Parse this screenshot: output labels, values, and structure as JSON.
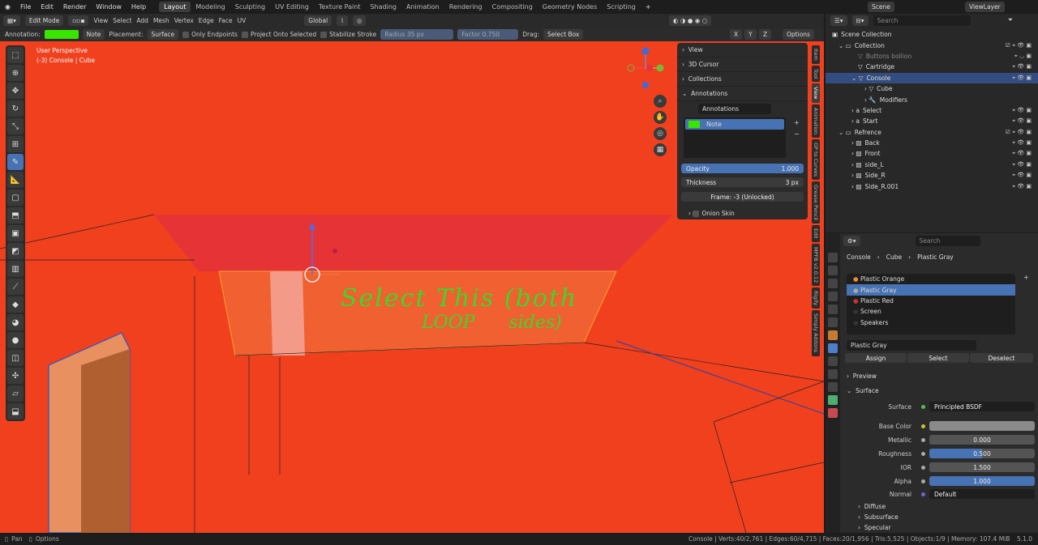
{
  "menu": [
    "File",
    "Edit",
    "Render",
    "Window",
    "Help"
  ],
  "workspaces": [
    "Layout",
    "Modeling",
    "Sculpting",
    "UV Editing",
    "Texture Paint",
    "Shading",
    "Animation",
    "Rendering",
    "Compositing",
    "Geometry Nodes",
    "Scripting"
  ],
  "scene": "Scene",
  "view_layer": "ViewLayer",
  "header": {
    "mode": "Edit Mode",
    "menus": [
      "View",
      "Select",
      "Add",
      "Mesh",
      "Vertex",
      "Edge",
      "Face",
      "UV"
    ],
    "orientation": "Global"
  },
  "toolsettings": {
    "annotation_label": "Annotation:",
    "annotation_color": "#39e600",
    "layer": "Note",
    "placement_label": "Placement:",
    "placement": "Surface",
    "only_endpoints": "Only Endpoints",
    "project": "Project Onto Selected",
    "stabilize": "Stabilize Stroke",
    "radius_label": "Radius",
    "radius": "35 px",
    "factor_label": "Factor",
    "factor": "0.750",
    "drag_label": "Drag:",
    "drag": "Select Box",
    "options": "Options",
    "axes": [
      "X",
      "Y",
      "Z"
    ]
  },
  "viewport": {
    "perspective": "User Perspective",
    "object": "(-3) Console | Cube",
    "annotation_line1": "Select This (both",
    "annotation_line2": "LOOP      sides)"
  },
  "npanel": {
    "sections": [
      "View",
      "3D Cursor",
      "Collections",
      "Annotations"
    ],
    "annotation_name": "Annotations",
    "layer": "Note",
    "opacity_label": "Opacity",
    "opacity": "1.000",
    "thickness_label": "Thickness",
    "thickness": "3 px",
    "frame": "Frame: -3 (Unlocked)",
    "onion": "Onion Skin"
  },
  "vtabs": [
    "Item",
    "Tool",
    "View",
    "Animation",
    "GP to Curves",
    "Grease Pencil",
    "Edit",
    "MPFB v2.0.12",
    "Rigify",
    "Simply Addons"
  ],
  "outliner": {
    "search_placeholder": "Search",
    "rows": [
      {
        "name": "Scene Collection",
        "indent": 0
      },
      {
        "name": "Collection",
        "indent": 1
      },
      {
        "name": "Buttons bollion",
        "indent": 2
      },
      {
        "name": "Cartridge",
        "indent": 2
      },
      {
        "name": "Console",
        "indent": 2
      },
      {
        "name": "Cube",
        "indent": 3
      },
      {
        "name": "Modifiers",
        "indent": 3
      },
      {
        "name": "Select",
        "indent": 2
      },
      {
        "name": "Start",
        "indent": 2
      },
      {
        "name": "Refrence",
        "indent": 1
      },
      {
        "name": "Back",
        "indent": 2
      },
      {
        "name": "Front",
        "indent": 2
      },
      {
        "name": "side_L",
        "indent": 2
      },
      {
        "name": "Side_R",
        "indent": 2
      },
      {
        "name": "Side_R.001",
        "indent": 2
      }
    ]
  },
  "properties": {
    "search_placeholder": "Search",
    "breadcrumb": [
      "Console",
      "Cube",
      "Plastic Gray"
    ],
    "materials": [
      "Plastic Orange",
      "Plastic Gray",
      "Plastic Red",
      "Screen",
      "Speakers"
    ],
    "material": "Plastic Gray",
    "assign": "Assign",
    "select": "Select",
    "deselect": "Deselect",
    "preview": "Preview",
    "surface_section": "Surface",
    "surface_label": "Surface",
    "surface": "Principled BSDF",
    "fields": [
      {
        "label": "Base Color",
        "value": ""
      },
      {
        "label": "Metallic",
        "value": "0.000"
      },
      {
        "label": "Roughness",
        "value": "0.500"
      },
      {
        "label": "IOR",
        "value": "1.500"
      },
      {
        "label": "Alpha",
        "value": "1.000"
      },
      {
        "label": "Normal",
        "value": "Default"
      }
    ],
    "subsections": [
      "Diffuse",
      "Subsurface",
      "Specular"
    ]
  },
  "status": {
    "pan": "Pan",
    "options": "Options",
    "info": "Console | Verts:40/2,761 | Edges:60/4,715 | Faces:20/1,956 | Tris:5,525 | Objects:1/9 | Memory: 107.4 MiB",
    "version": "5.1.0"
  }
}
